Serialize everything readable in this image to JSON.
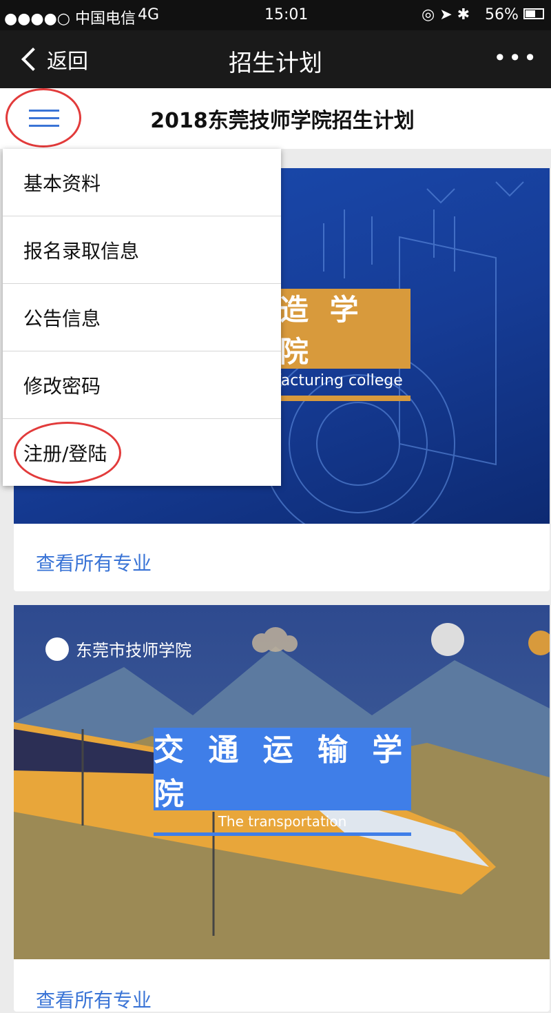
{
  "status_bar": {
    "carrier": "●●●●○ 中国电信",
    "network": "4G",
    "time": "15:01",
    "battery": "56%"
  },
  "nav": {
    "back_label": "返回",
    "title": "招生计划",
    "more_label": "•••"
  },
  "page": {
    "title": "2018东莞技师学院招生计划"
  },
  "menu": {
    "items": [
      "基本资料",
      "报名录取信息",
      "公告信息",
      "修改密码",
      "注册/登陆"
    ]
  },
  "cards": [
    {
      "title": "造 学 院",
      "subtitle": "facturing college",
      "link": "查看所有专业"
    },
    {
      "title": "交 通 运 输 学 院",
      "subtitle": "The transportation",
      "logo_text": "东莞市技师学院",
      "link": "查看所有专业"
    }
  ],
  "colors": {
    "accent": "#3a74d6",
    "annotation": "#e23b3b",
    "orange": "#d89a3c"
  }
}
